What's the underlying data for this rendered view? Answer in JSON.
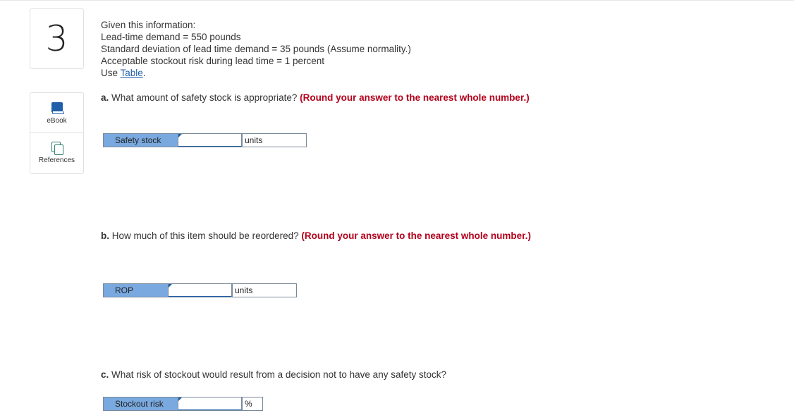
{
  "question": {
    "number": "3"
  },
  "side": {
    "ebook_label": "eBook",
    "references_label": "References"
  },
  "info": {
    "intro": "Given this information:",
    "line1": "Lead-time demand = 550 pounds",
    "line2": "Standard deviation of lead time demand = 35 pounds (Assume normality.)",
    "line3": "Acceptable stockout risk during lead time = 1 percent",
    "use_prefix": "Use ",
    "table_link": "Table",
    "use_suffix": "."
  },
  "part_a": {
    "prefix": "a.",
    "question": " What amount of safety stock is appropriate? ",
    "instruction": "(Round your answer to the nearest whole number.)",
    "label": "Safety stock",
    "value": "",
    "unit": "units"
  },
  "part_b": {
    "prefix": "b.",
    "question": " How much of this item should be reordered? ",
    "instruction": "(Round your answer to the nearest whole number.)",
    "label": "ROP",
    "value": "",
    "unit": "units"
  },
  "part_c": {
    "prefix": "c.",
    "question": " What risk of stockout would result from a decision not to have any safety stock?",
    "label": "Stockout risk",
    "value": "",
    "unit": "%"
  }
}
